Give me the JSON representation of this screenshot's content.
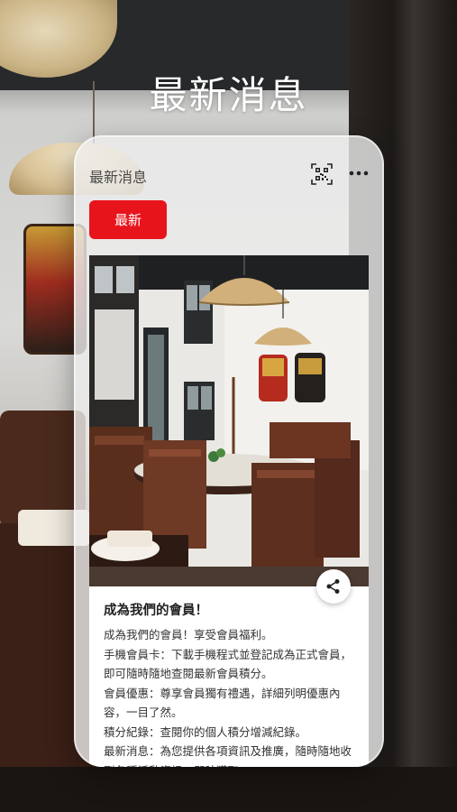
{
  "header": {
    "title": "最新消息"
  },
  "app_bar": {
    "title": "最新消息",
    "qr_icon": "qr-code-icon",
    "more_icon": "more-horizontal-icon",
    "more_glyph": "•••"
  },
  "tabs": [
    {
      "label": "最新",
      "active": true
    }
  ],
  "news": {
    "title": "成為我們的會員！",
    "share_icon": "share-icon",
    "paragraphs": [
      "成為我們的會員！享受會員福利。",
      "手機會員卡：下載手機程式並登記成為正式會員，即可隨時隨地查閱最新會員積分。",
      "會員優惠：尊享會員獨有禮遇，詳細列明優惠內容，一目了然。",
      "積分紀錄：查閱你的個人積分增減紀錄。",
      "最新消息：為您提供各項資訊及推廣，隨時隨地收到各種活動資訊，即時獲取。"
    ]
  },
  "colors": {
    "accent": "#e8141c",
    "card_background": "#ffffff",
    "title_text": "#ffffff"
  }
}
